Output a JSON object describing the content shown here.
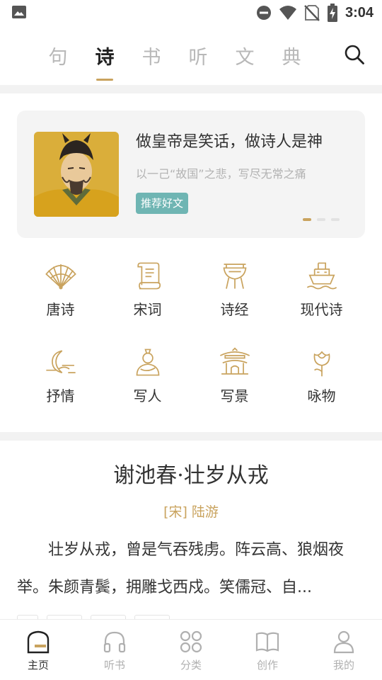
{
  "status_bar": {
    "time": "3:04"
  },
  "top_tabs": [
    {
      "label": "句",
      "active": false
    },
    {
      "label": "诗",
      "active": true
    },
    {
      "label": "书",
      "active": false
    },
    {
      "label": "听",
      "active": false
    },
    {
      "label": "文",
      "active": false
    },
    {
      "label": "典",
      "active": false
    }
  ],
  "banner": {
    "title": "做皇帝是笑话，做诗人是神",
    "subtitle": "以一己“故国”之悲，写尽无常之痛",
    "tag": "推荐好文",
    "page_count": 3,
    "active_page": 1
  },
  "categories": [
    {
      "label": "唐诗",
      "icon": "fan-icon"
    },
    {
      "label": "宋词",
      "icon": "scroll-icon"
    },
    {
      "label": "诗经",
      "icon": "ritual-vessel-icon"
    },
    {
      "label": "现代诗",
      "icon": "ship-icon"
    },
    {
      "label": "抒情",
      "icon": "moon-icon"
    },
    {
      "label": "写人",
      "icon": "person-icon"
    },
    {
      "label": "写景",
      "icon": "pavilion-icon"
    },
    {
      "label": "咏物",
      "icon": "flower-icon"
    }
  ],
  "poem": {
    "title": "谢池春·壮岁从戎",
    "author": "[宋] 陆游",
    "body": "壮岁从戎，曾是气吞残虏。阵云高、狼烟夜举。朱颜青鬓，拥雕戈西戍。笑儒冠、自..."
  },
  "bottom_nav": [
    {
      "label": "主页",
      "icon": "home-icon",
      "active": true
    },
    {
      "label": "听书",
      "icon": "headphones-icon",
      "active": false
    },
    {
      "label": "分类",
      "icon": "grid-icon",
      "active": false
    },
    {
      "label": "创作",
      "icon": "book-icon",
      "active": false
    },
    {
      "label": "我的",
      "icon": "user-icon",
      "active": false
    }
  ],
  "colors": {
    "accent": "#c9a35e",
    "tag": "#6fb5b3",
    "page_bg": "#f2f2f2"
  }
}
